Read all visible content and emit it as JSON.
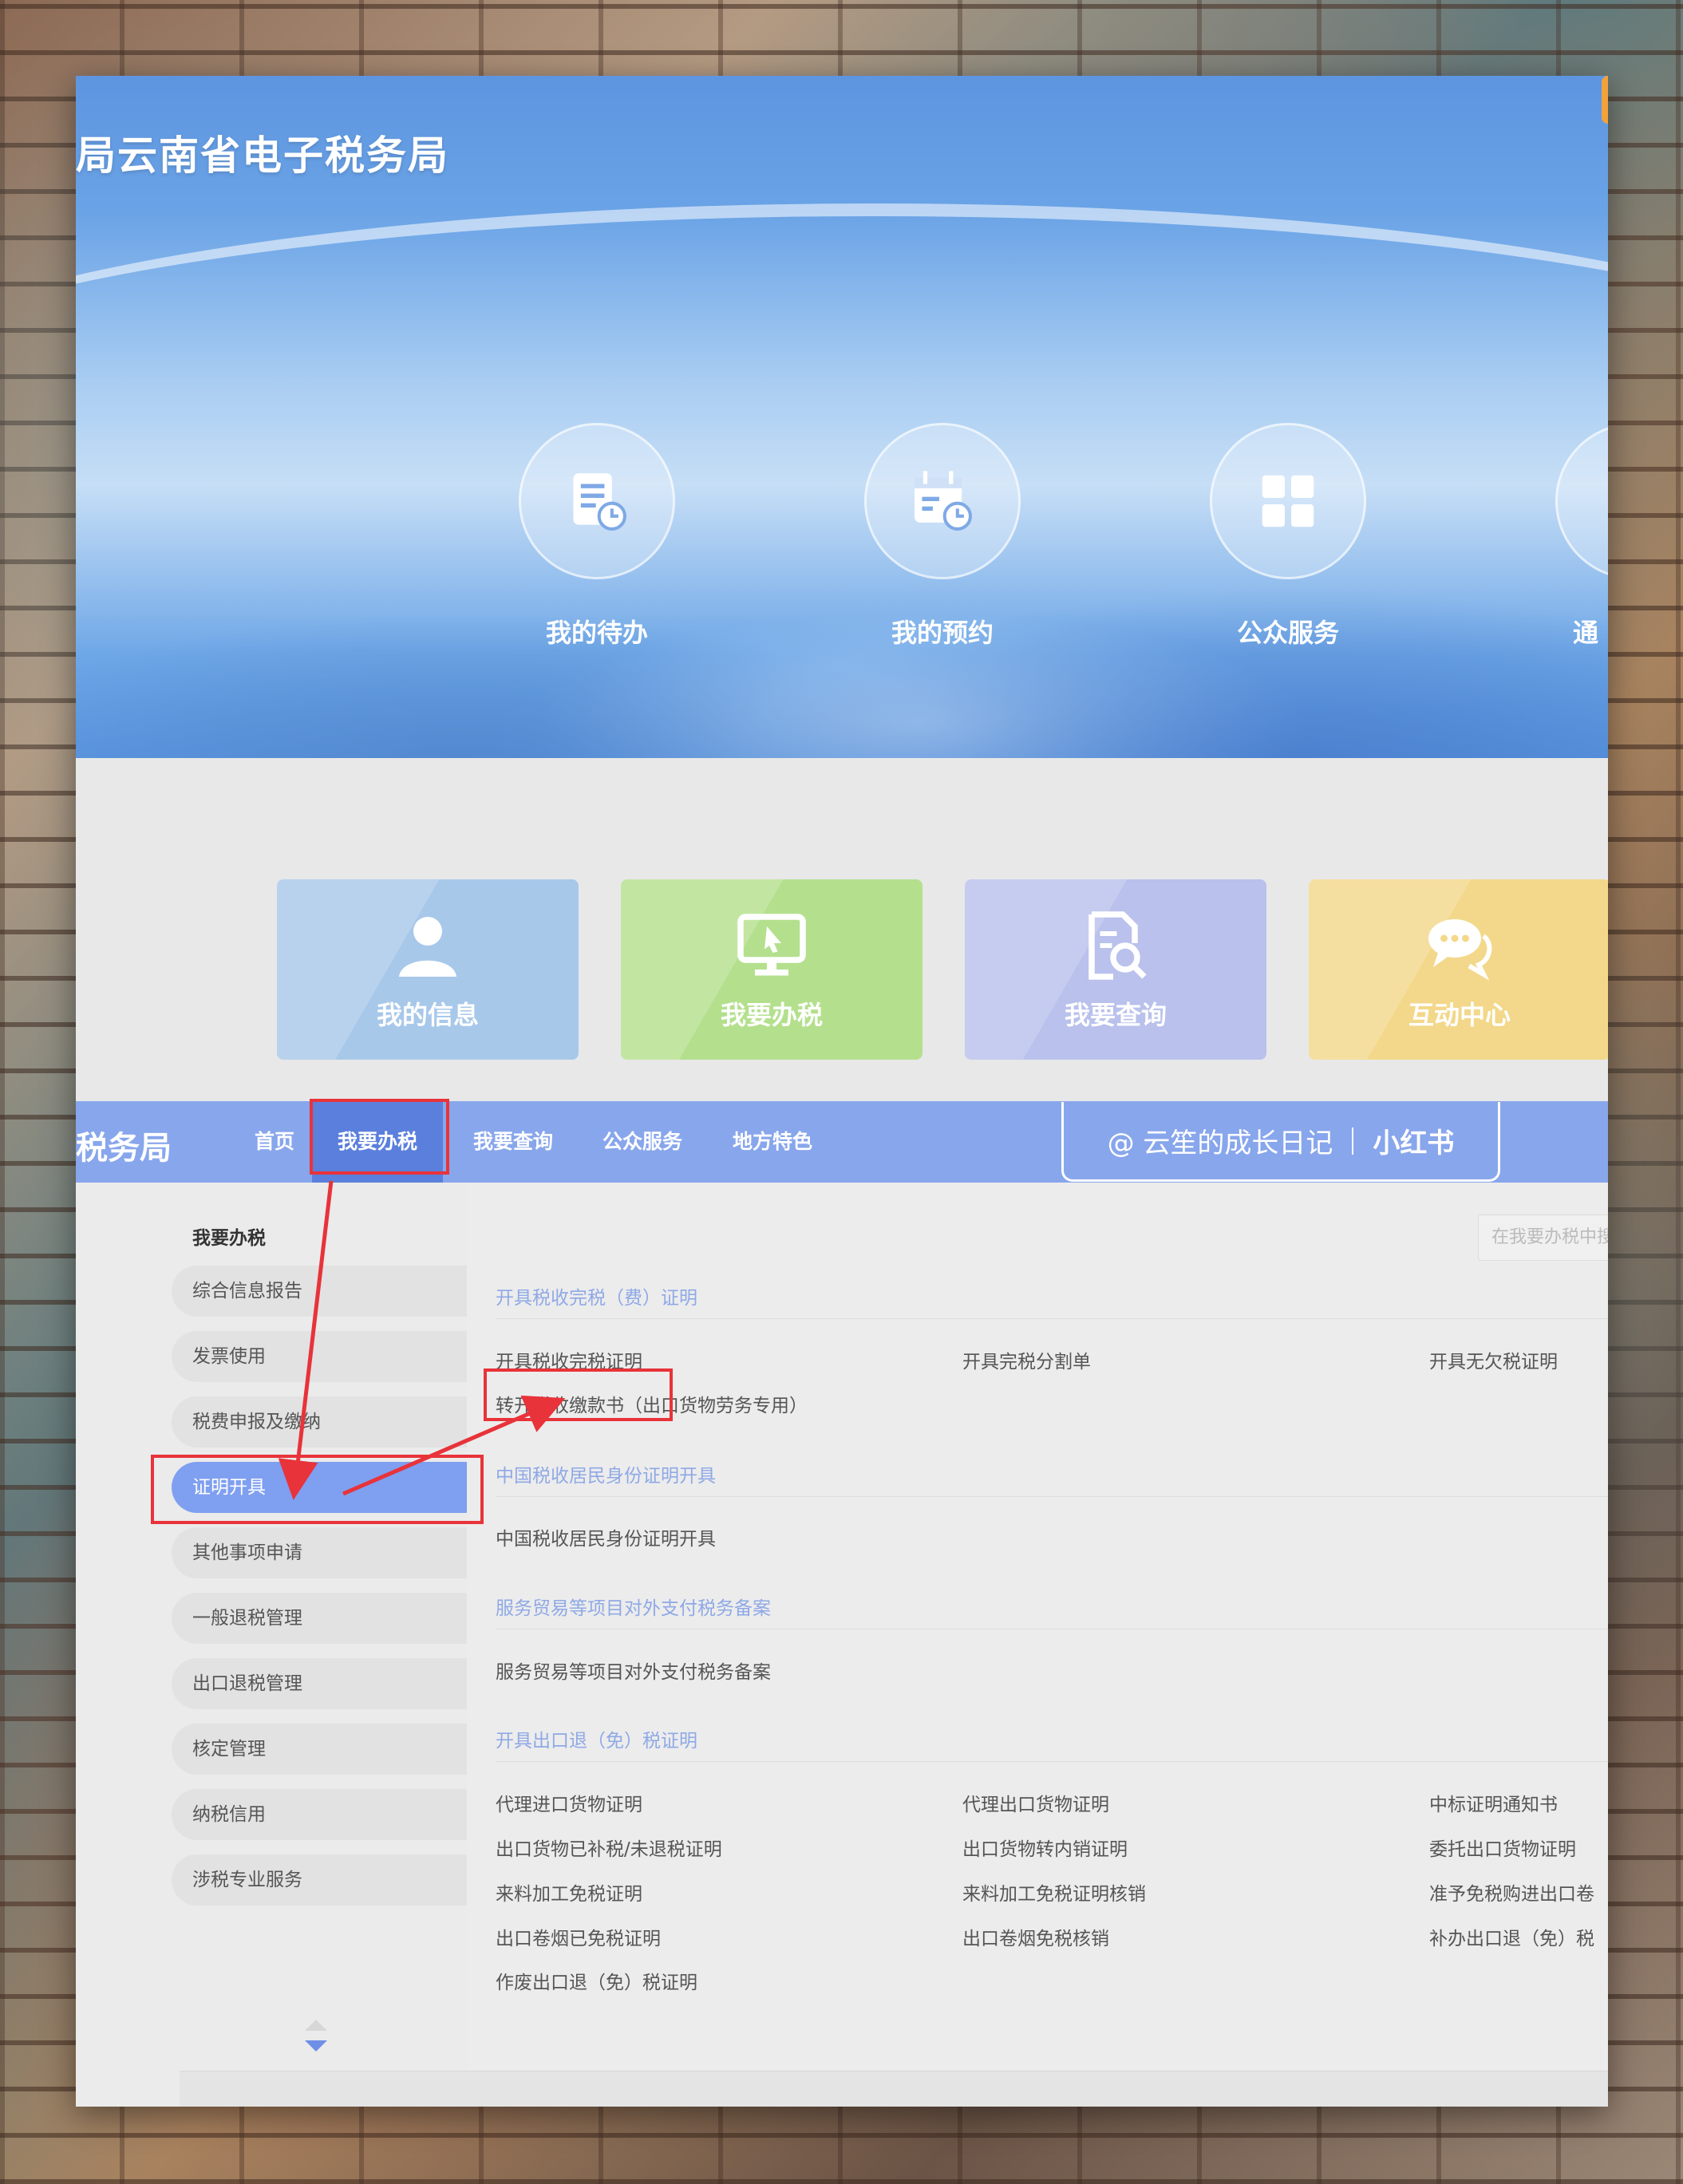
{
  "header": {
    "site_title": "局云南省电子税务局"
  },
  "quick_circles": [
    {
      "label": "我的待办",
      "icon": "todo-doc-icon"
    },
    {
      "label": "我的预约",
      "icon": "calendar-clock-icon"
    },
    {
      "label": "公众服务",
      "icon": "grid-icon"
    },
    {
      "label": "通",
      "icon": "notice-icon"
    }
  ],
  "tiles": [
    {
      "label": "我的信息",
      "icon": "user-icon",
      "color": "#a8c8ea"
    },
    {
      "label": "我要办税",
      "icon": "monitor-cursor-icon",
      "color": "#b4e08e"
    },
    {
      "label": "我要查询",
      "icon": "doc-search-icon",
      "color": "#b9c1ec"
    },
    {
      "label": "互动中心",
      "icon": "chat-bubbles-icon",
      "color": "#f3d88b"
    }
  ],
  "nav": {
    "brand": "税务局",
    "items": [
      "首页",
      "我要办税",
      "我要查询",
      "公众服务",
      "地方特色"
    ],
    "active_index": 1
  },
  "watermark": {
    "text": "@ 云笙的成长日记",
    "brand": "小红书"
  },
  "sidebar": {
    "title": "我要办税",
    "items": [
      "综合信息报告",
      "发票使用",
      "税费申报及缴纳",
      "证明开具",
      "其他事项申请",
      "一般退税管理",
      "出口退税管理",
      "核定管理",
      "纳税信用",
      "涉税专业服务"
    ],
    "active_index": 3
  },
  "content": {
    "search_placeholder": "在我要办税中搜",
    "sections": [
      {
        "title": "开具税收完税（费）证明",
        "links": [
          "开具税收完税证明",
          "开具完税分割单",
          "开具无欠税证明",
          "转开税收缴款书（出口货物劳务专用）"
        ]
      },
      {
        "title": "中国税收居民身份证明开具",
        "links": [
          "中国税收居民身份证明开具"
        ]
      },
      {
        "title": "服务贸易等项目对外支付税务备案",
        "links": [
          "服务贸易等项目对外支付税务备案"
        ]
      },
      {
        "title": "开具出口退（免）税证明",
        "links": [
          "代理进口货物证明",
          "代理出口货物证明",
          "中标证明通知书",
          "出口货物已补税/未退税证明",
          "出口货物转内销证明",
          "委托出口货物证明",
          "来料加工免税证明",
          "来料加工免税证明核销",
          "准予免税购进出口卷",
          "出口卷烟已免税证明",
          "出口卷烟免税核销",
          "补办出口退（免）税",
          "作废出口退（免）税证明"
        ]
      }
    ]
  },
  "colors": {
    "nav_bg": "#88a6ec",
    "nav_active": "#5b7fdc",
    "sidebar_active": "#7f9ff0",
    "annotation_red": "#e8333a",
    "section_title": "#8fa9e6"
  }
}
